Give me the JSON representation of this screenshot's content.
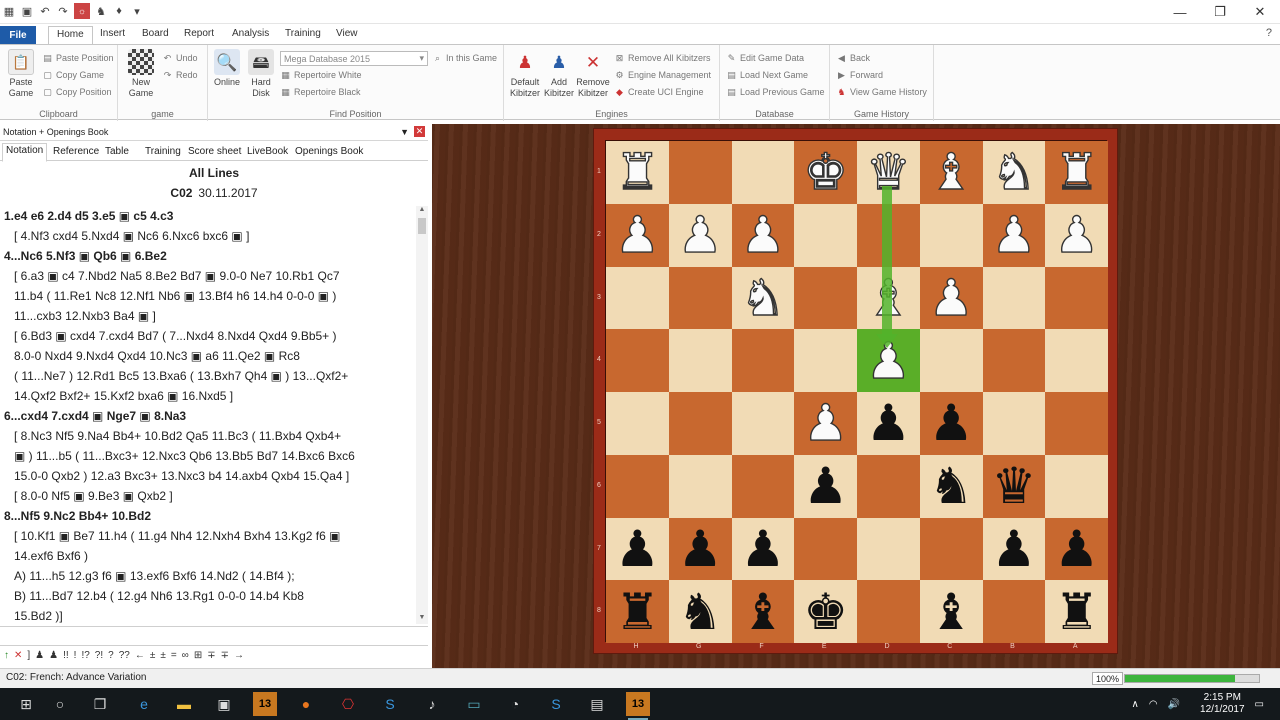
{
  "ribbon": {
    "file_label": "File",
    "tabs": [
      "Home",
      "Insert",
      "Board",
      "Report",
      "Analysis",
      "Training",
      "View"
    ],
    "active_tab": "Home",
    "clipboard": {
      "paste_game": "Paste Game",
      "paste_position": "Paste Position",
      "copy_game": "Copy Game",
      "copy_position": "Copy Position",
      "group": "Clipboard"
    },
    "game": {
      "new_game": "New Game",
      "undo": "Undo",
      "redo": "Redo",
      "group": "game"
    },
    "find_position": {
      "online": "Online",
      "hard_disk": "Hard Disk",
      "database_value": "Mega Database 2015",
      "in_this_game": "In this Game",
      "repertoire_white": "Repertoire White",
      "repertoire_black": "Repertoire Black",
      "group": "Find Position"
    },
    "engines": {
      "default_kibitzer": "Default Kibitzer",
      "add_kibitzer": "Add Kibitzer",
      "remove_kibitzer": "Remove Kibitzer",
      "remove_all": "Remove All Kibitzers",
      "engine_management": "Engine Management",
      "create_uci": "Create UCI Engine",
      "group": "Engines"
    },
    "database": {
      "edit_game_data": "Edit Game Data",
      "load_next": "Load Next Game",
      "load_previous": "Load Previous Game",
      "group": "Database"
    },
    "history": {
      "back": "Back",
      "forward": "Forward",
      "view_history": "View Game History",
      "group": "Game History"
    }
  },
  "panel": {
    "title": "Notation + Openings Book",
    "tabs": [
      "Notation",
      "Reference",
      "Table",
      "Training",
      "Score sheet",
      "LiveBook",
      "Openings Book"
    ],
    "active_tab": "Notation",
    "lines_title": "All Lines",
    "eco_code": "C02",
    "date": "30.11.2017"
  },
  "notation_lines": [
    {
      "type": "main",
      "text": "1.e4  e6  2.d4  d5  3.e5 ▣ c5  4.c3"
    },
    {
      "type": "var",
      "text": "[ 4.Nf3  cxd4  5.Nxd4 ▣ Nc6  6.Nxc6  bxc6 ▣ ]"
    },
    {
      "type": "main",
      "text": "4...Nc6  5.Nf3 ▣ Qb6 ▣ 6.Be2"
    },
    {
      "type": "var",
      "text": "[ 6.a3 ▣ c4  7.Nbd2  Na5  8.Be2  Bd7 ▣ 9.0-0  Ne7  10.Rb1  Qc7"
    },
    {
      "type": "var",
      "text": "11.b4  ( 11.Re1  Nc8  12.Nf1  Nb6 ▣ 13.Bf4  h6  14.h4  0-0-0 ▣ )"
    },
    {
      "type": "var",
      "text": "11...cxb3  12.Nxb3  Ba4 ▣ ]"
    },
    {
      "type": "var",
      "text": "[ 6.Bd3 ▣ cxd4  7.cxd4  Bd7  ( 7...Nxd4  8.Nxd4  Qxd4  9.Bb5+ )"
    },
    {
      "type": "var",
      "text": "8.0-0  Nxd4  9.Nxd4  Qxd4  10.Nc3 ▣ a6  11.Qe2 ▣ Rc8"
    },
    {
      "type": "var",
      "text": "( 11...Ne7 )  12.Rd1  Bc5  13.Bxa6  ( 13.Bxh7  Qh4 ▣ )  13...Qxf2+"
    },
    {
      "type": "var",
      "text": "14.Qxf2  Bxf2+  15.Kxf2  bxa6 ▣ 16.Nxd5 ]"
    },
    {
      "type": "main",
      "text": "6...cxd4  7.cxd4 ▣ Nge7 ▣ 8.Na3"
    },
    {
      "type": "var",
      "text": "[ 8.Nc3  Nf5  9.Na4  Bb4+  10.Bd2  Qa5  11.Bc3  ( 11.Bxb4  Qxb4+"
    },
    {
      "type": "var",
      "text": "▣ )  11...b5  ( 11...Bxc3+  12.Nxc3  Qb6  13.Bb5  Bd7  14.Bxc6  Bxc6"
    },
    {
      "type": "var",
      "text": "15.0-0  Qxb2 )  12.a3  Bxc3+  13.Nxc3  b4  14.axb4  Qxb4  15.Qa4 ]"
    },
    {
      "type": "var",
      "text": "[ 8.0-0  Nf5 ▣ 9.Be3 ▣ Qxb2 ]"
    },
    {
      "type": "main",
      "text": "8...Nf5  9.Nc2  Bb4+  10.Bd2"
    },
    {
      "type": "var",
      "text": "[ 10.Kf1 ▣ Be7  11.h4  ( 11.g4  Nh4  12.Nxh4  Bxh4  13.Kg2  f6 ▣"
    },
    {
      "type": "var",
      "text": "14.exf6  Bxf6 )"
    },
    {
      "type": "var",
      "text": "  A)  11...h5  12.g3  f6 ▣ 13.exf6  Bxf6  14.Nd2  ( 14.Bf4 );"
    },
    {
      "type": "var",
      "text": "  B)  11...Bd7  12.b4  ( 12.g4  Nh6  13.Rg1  0-0-0  14.b4  Kb8"
    },
    {
      "type": "var",
      "text": "15.Bd2 )]"
    }
  ],
  "annotation_symbols": [
    "↑",
    "✕",
    "]",
    "♟",
    "♟",
    "!!",
    "!",
    "!?",
    "?!",
    "?",
    "??",
    "←",
    "±",
    "±",
    "=",
    "∞",
    "⊞",
    "∓",
    "∓",
    "→"
  ],
  "board": {
    "rank_labels": [
      "1",
      "2",
      "3",
      "4",
      "5",
      "6",
      "7",
      "8"
    ],
    "file_labels": [
      "H",
      "G",
      "F",
      "E",
      "D",
      "C",
      "B",
      "A"
    ],
    "highlight": [
      3,
      4
    ],
    "rows": [
      [
        "wR",
        "",
        "",
        "wK",
        "wQ",
        "wB",
        "wN",
        "wR"
      ],
      [
        "wP",
        "wP",
        "wP",
        "",
        "",
        "",
        "wP",
        "wP"
      ],
      [
        "",
        "",
        "wN",
        "",
        "wB",
        "wP",
        "",
        ""
      ],
      [
        "",
        "",
        "",
        "",
        "wP",
        "",
        "",
        ""
      ],
      [
        "",
        "",
        "",
        "wP",
        "bP",
        "bP",
        "",
        ""
      ],
      [
        "",
        "",
        "",
        "bP",
        "",
        "bN",
        "bQ",
        ""
      ],
      [
        "bP",
        "bP",
        "bP",
        "",
        "",
        "",
        "bP",
        "bP"
      ],
      [
        "bR",
        "bN",
        "bB",
        "bK",
        "",
        "bB",
        "",
        "bR"
      ]
    ]
  },
  "status": {
    "opening": "C02: French: Advance Variation",
    "zoom": "100%",
    "zoom_fraction": 0.82
  },
  "taskbar": {
    "time": "2:15 PM",
    "date": "12/1/2017"
  }
}
